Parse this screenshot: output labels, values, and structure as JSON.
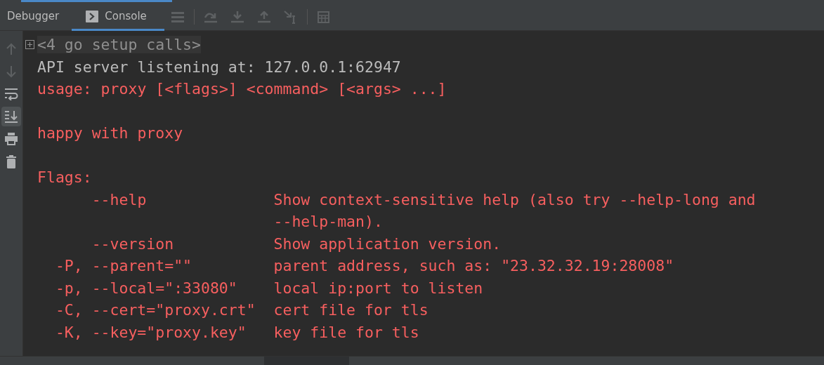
{
  "tabs": [
    {
      "label": "Debugger",
      "selected": false,
      "icon": false
    },
    {
      "label": "Console",
      "selected": true,
      "icon": true
    }
  ],
  "side_toolbar": [
    {
      "kind": "up",
      "disabled": true,
      "selected": false
    },
    {
      "kind": "down",
      "disabled": true,
      "selected": false
    },
    {
      "kind": "wrap",
      "disabled": false,
      "selected": false
    },
    {
      "kind": "scroll-end",
      "disabled": false,
      "selected": true
    },
    {
      "kind": "print",
      "disabled": false,
      "selected": false
    },
    {
      "kind": "trash",
      "disabled": false,
      "selected": false
    }
  ],
  "console": [
    {
      "kind": "fold",
      "text": "<4 go setup calls>"
    },
    {
      "kind": "line",
      "error": false,
      "text": "API server listening at: 127.0.0.1:62947"
    },
    {
      "kind": "line",
      "error": true,
      "text": "usage: proxy [<flags>] <command> [<args> ...]"
    },
    {
      "kind": "blank"
    },
    {
      "kind": "line",
      "error": true,
      "text": "happy with proxy"
    },
    {
      "kind": "blank"
    },
    {
      "kind": "line",
      "error": true,
      "text": "Flags:"
    },
    {
      "kind": "flag",
      "long_only": true,
      "flag": "--help",
      "help": "Show context-sensitive help (also try --help-long and"
    },
    {
      "kind": "flag",
      "help": "--help-man)."
    },
    {
      "kind": "flag",
      "long_only": true,
      "flag": "--version",
      "help": "Show application version."
    },
    {
      "kind": "flag",
      "long_only": false,
      "flag": "-P, --parent=\"\"",
      "help": "parent address, such as: \"23.32.32.19:28008\""
    },
    {
      "kind": "flag",
      "long_only": false,
      "flag": "-p, --local=\":33080\"",
      "help": "local ip:port to listen"
    },
    {
      "kind": "flag",
      "long_only": false,
      "flag": "-C, --cert=\"proxy.crt\"",
      "help": "cert file for tls"
    },
    {
      "kind": "flag",
      "long_only": false,
      "flag": "-K, --key=\"proxy.key\"",
      "help": "key file for tls"
    }
  ]
}
